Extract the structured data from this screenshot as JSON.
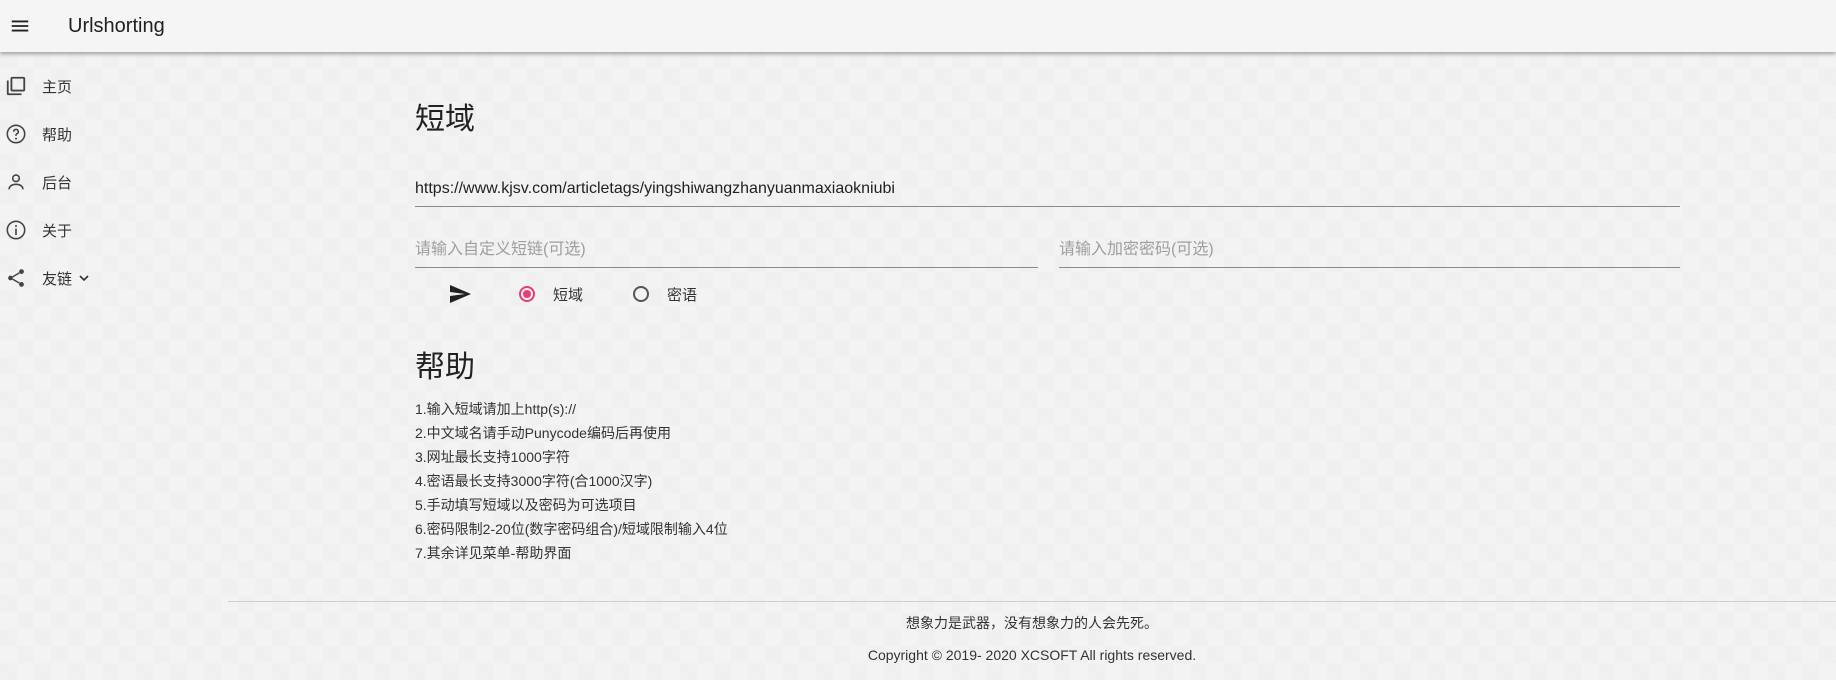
{
  "appbar": {
    "title": "Urlshorting",
    "menu_icon": "menu-icon"
  },
  "sidebar": {
    "items": [
      {
        "label": "主页",
        "icon": "library-icon"
      },
      {
        "label": "帮助",
        "icon": "help-circle-icon"
      },
      {
        "label": "后台",
        "icon": "person-icon"
      },
      {
        "label": "关于",
        "icon": "info-icon"
      },
      {
        "label": "友链",
        "icon": "share-icon",
        "has_dropdown": true
      }
    ]
  },
  "main": {
    "title": "短域",
    "url_value": "https://www.kjsv.com/articletags/yingshiwangzhanyuanmaxiaokniubi",
    "custom_placeholder": "请输入自定义短链(可选)",
    "password_placeholder": "请输入加密密码(可选)",
    "radio_short": "短域",
    "radio_secret": "密语",
    "selected_mode": "短域",
    "accent_color": "#e83e73"
  },
  "help": {
    "title": "帮助",
    "items": [
      "1.输入短域请加上http(s)://",
      "2.中文域名请手动Punycode编码后再使用",
      "3.网址最长支持1000字符",
      "4.密语最长支持3000字符(合1000汉字)",
      "5.手动填写短域以及密码为可选项目",
      "6.密码限制2-20位(数字密码组合)/短域限制输入4位",
      "7.其余详见菜单-帮助界面"
    ]
  },
  "footer": {
    "quote": "想象力是武器，没有想象力的人会先死。",
    "copyright": "Copyright © 2019- 2020 XCSOFT All rights reserved."
  }
}
